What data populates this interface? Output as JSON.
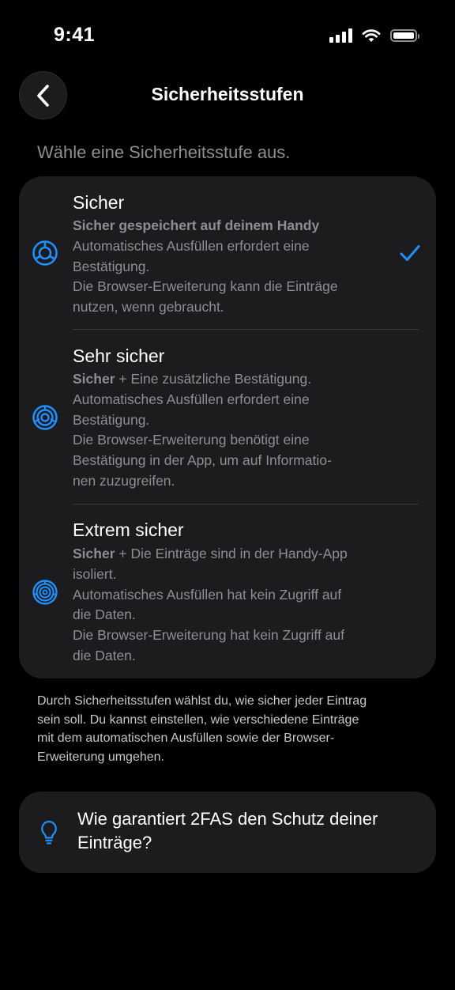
{
  "status_bar": {
    "time": "9:41"
  },
  "header": {
    "title": "Sicherheitsstufen",
    "back_icon": "chevron-left-icon"
  },
  "section_heading": "Wähle eine Sicherheitsstufe aus.",
  "options": [
    {
      "title": "Sicher",
      "icon": "security-level-1-icon",
      "selected": true,
      "lead": "Sicher gespeichert auf deinem Handy",
      "lead_rest": "",
      "lines": [
        "Automatisches Ausfüllen erfordert eine",
        "Bestätigung.",
        "Die Browser-Erweiterung kann die Einträge",
        "nutzen, wenn gebraucht."
      ]
    },
    {
      "title": "Sehr sicher",
      "icon": "security-level-2-icon",
      "selected": false,
      "lead": "Sicher",
      "lead_rest": " + Eine zusätzliche Bestätigung.",
      "lines": [
        "Automatisches Ausfüllen erfordert eine",
        "Bestätigung.",
        "Die Browser-Erweiterung benötigt eine",
        "Bestätigung in der App, um auf Informatio-",
        "nen zuzugreifen."
      ]
    },
    {
      "title": "Extrem sicher",
      "icon": "security-level-3-icon",
      "selected": false,
      "lead": "Sicher",
      "lead_rest": " + Die Einträge sind in der Handy-App",
      "lines": [
        "isoliert.",
        "Automatisches Ausfüllen hat kein Zugriff auf",
        "die Daten.",
        "Die Browser-Erweiterung hat kein Zugriff auf",
        "die Daten."
      ]
    }
  ],
  "footer_lines": [
    "Durch Sicherheitsstufen wählst du, wie sicher jeder Eintrag",
    "sein soll. Du kannst einstellen, wie verschiedene Einträge",
    "mit dem automatischen Ausfüllen sowie der Browser-",
    "Erweiterung umgehen."
  ],
  "info": {
    "icon": "lightbulb-icon",
    "lines": [
      "Wie garantiert 2FAS den Schutz deiner",
      "Einträge?"
    ]
  },
  "colors": {
    "accent": "#1f8fff",
    "card": "#1c1c1e",
    "secondary_text": "#8e8e93"
  }
}
